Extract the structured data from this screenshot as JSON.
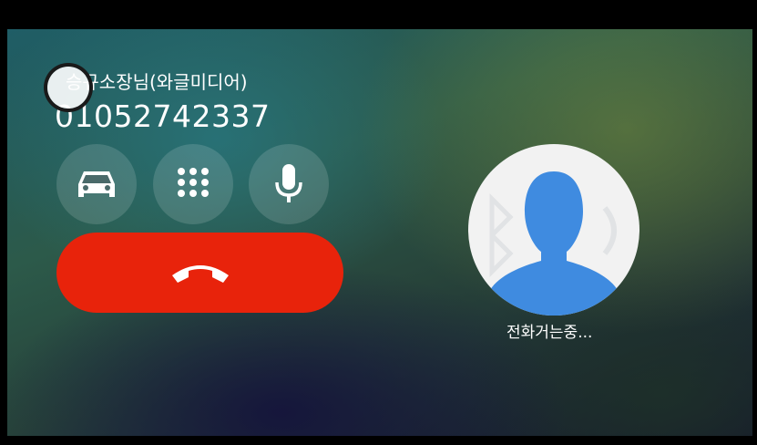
{
  "call": {
    "caller_name": "승규소장님(와글미디어)",
    "caller_number": "01052742337",
    "status": "전화거는중..."
  },
  "controls": {
    "car_icon": "car-icon",
    "keypad_icon": "keypad-icon",
    "mic_icon": "microphone-icon",
    "end_call_icon": "end-call-icon"
  },
  "colors": {
    "end_call": "#e8230b",
    "avatar_bg": "#f2f2f2",
    "avatar_person": "#3f8be0",
    "text": "#ffffff"
  }
}
